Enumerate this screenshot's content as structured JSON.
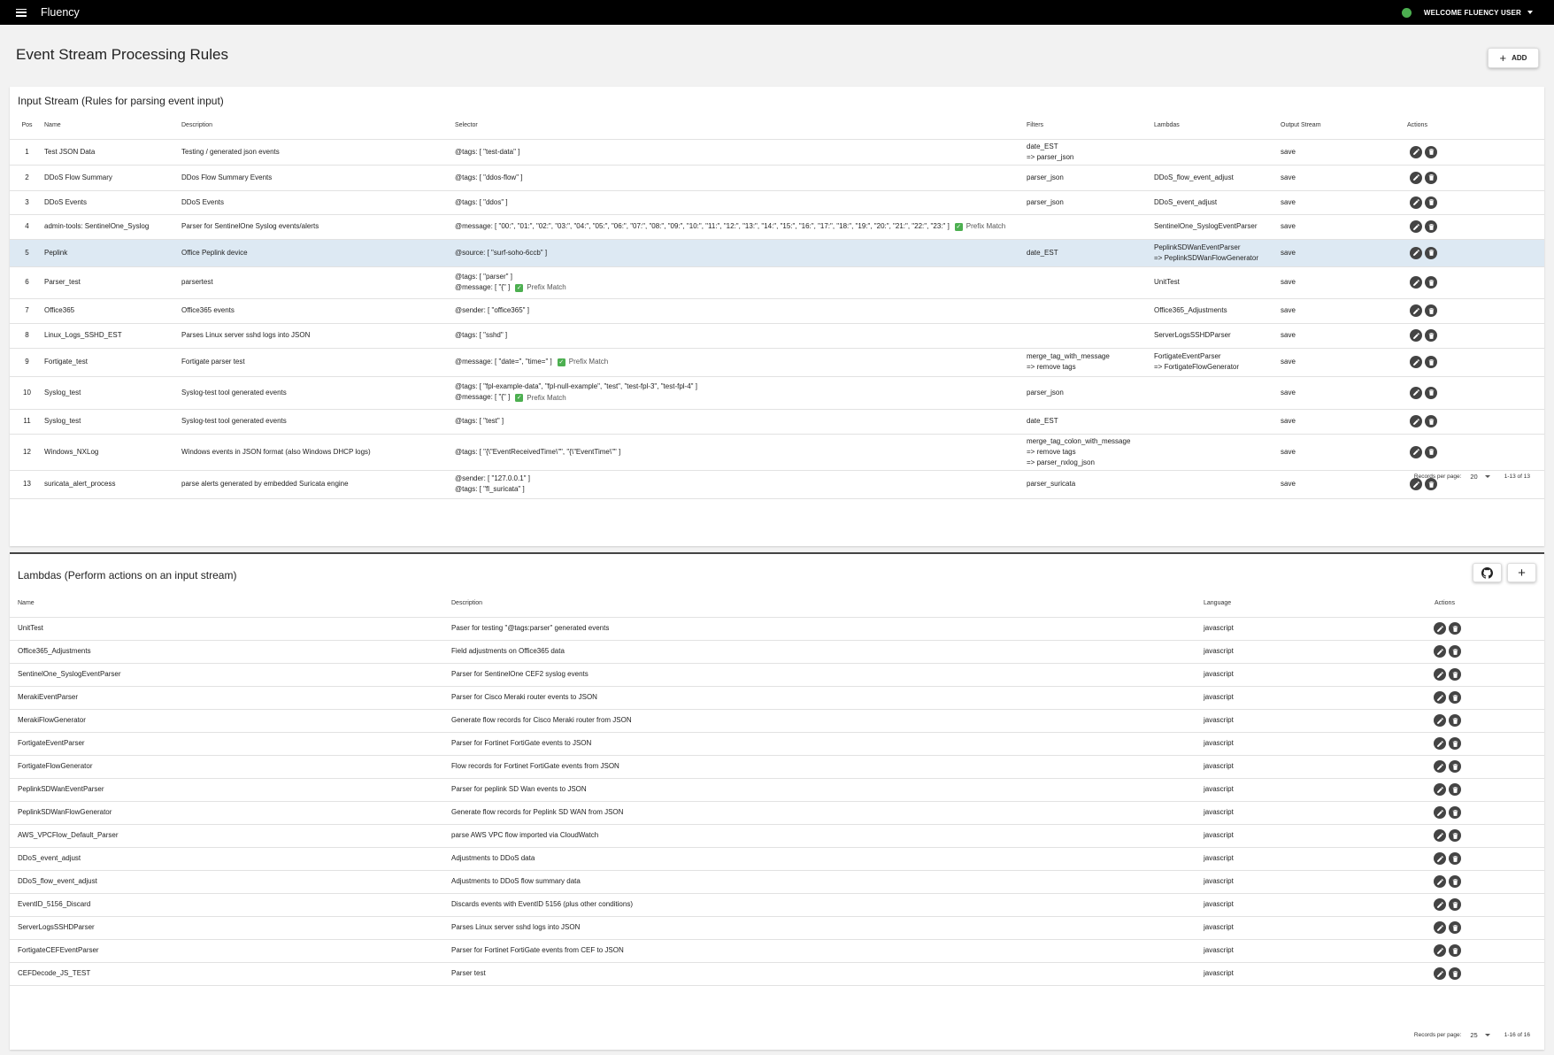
{
  "app": {
    "title": "Fluency",
    "user_label": "WELCOME FLUENCY USER",
    "status_color": "#4caf50"
  },
  "page": {
    "title": "Event Stream Processing Rules",
    "add_label": "ADD"
  },
  "input_stream": {
    "title": "Input Stream (Rules for parsing event input)",
    "columns": [
      "Pos",
      "Name",
      "Description",
      "Selector",
      "Filters",
      "Lambdas",
      "Output Stream",
      "Actions"
    ],
    "rows": [
      {
        "pos": "1",
        "name": "Test JSON Data",
        "description": "Testing / generated json events",
        "selector": [
          {
            "text": "@tags: [ \"test-data\" ]",
            "prefix": false
          }
        ],
        "filters": [
          "date_EST",
          "=> parser_json"
        ],
        "lambdas": [],
        "output": "save",
        "selected": false
      },
      {
        "pos": "2",
        "name": "DDoS Flow Summary",
        "description": "DDos Flow Summary Events",
        "selector": [
          {
            "text": "@tags: [ \"ddos-flow\" ]",
            "prefix": false
          }
        ],
        "filters": [
          "parser_json"
        ],
        "lambdas": [
          "DDoS_flow_event_adjust"
        ],
        "output": "save",
        "selected": false
      },
      {
        "pos": "3",
        "name": "DDoS Events",
        "description": "DDoS Events",
        "selector": [
          {
            "text": "@tags: [ \"ddos\" ]",
            "prefix": false
          }
        ],
        "filters": [
          "parser_json"
        ],
        "lambdas": [
          "DDoS_event_adjust"
        ],
        "output": "save",
        "selected": false
      },
      {
        "pos": "4",
        "name": "admin-tools: SentinelOne_Syslog",
        "description": "Parser for SentinelOne Syslog events/alerts",
        "selector": [
          {
            "text": "@message: [ \"00:\", \"01:\", \"02:\", \"03:\", \"04:\", \"05:\", \"06:\", \"07:\", \"08:\", \"09:\", \"10:\", \"11:\", \"12:\", \"13:\", \"14:\", \"15:\", \"16:\", \"17:\", \"18:\", \"19:\", \"20:\", \"21:\", \"22:\", \"23:\" ]",
            "prefix": true
          }
        ],
        "filters": [],
        "lambdas": [
          "SentinelOne_SyslogEventParser"
        ],
        "output": "save",
        "selected": false
      },
      {
        "pos": "5",
        "name": "Peplink",
        "description": "Office Peplink device",
        "selector": [
          {
            "text": "@source: [ \"surf-soho-6ccb\" ]",
            "prefix": false
          }
        ],
        "filters": [
          "date_EST"
        ],
        "lambdas": [
          "PeplinkSDWanEventParser",
          "=> PeplinkSDWanFlowGenerator"
        ],
        "output": "save",
        "selected": true
      },
      {
        "pos": "6",
        "name": "Parser_test",
        "description": "parsertest",
        "selector": [
          {
            "text": "@tags: [ \"parser\" ]",
            "prefix": false
          },
          {
            "text": "@message: [ \"{\" ]",
            "prefix": true
          }
        ],
        "filters": [],
        "lambdas": [
          "UnitTest"
        ],
        "output": "save",
        "selected": false
      },
      {
        "pos": "7",
        "name": "Office365",
        "description": "Office365 events",
        "selector": [
          {
            "text": "@sender: [ \"office365\" ]",
            "prefix": false
          }
        ],
        "filters": [],
        "lambdas": [
          "Office365_Adjustments"
        ],
        "output": "save",
        "selected": false
      },
      {
        "pos": "8",
        "name": "Linux_Logs_SSHD_EST",
        "description": "Parses Linux server sshd logs into JSON",
        "selector": [
          {
            "text": "@tags: [ \"sshd\" ]",
            "prefix": false
          }
        ],
        "filters": [],
        "lambdas": [
          "ServerLogsSSHDParser"
        ],
        "output": "save",
        "selected": false
      },
      {
        "pos": "9",
        "name": "Fortigate_test",
        "description": "Fortigate parser test",
        "selector": [
          {
            "text": "@message: [ \"date=\", \"time=\" ]",
            "prefix": true
          }
        ],
        "filters": [
          "merge_tag_with_message",
          "=> remove tags"
        ],
        "lambdas": [
          "FortigateEventParser",
          "=> FortigateFlowGenerator"
        ],
        "output": "save",
        "selected": false
      },
      {
        "pos": "10",
        "name": "Syslog_test",
        "description": "Syslog-test tool generated events",
        "selector": [
          {
            "text": "@tags: [ \"fpl-example-data\", \"fpl-null-example\", \"test\", \"test-fpl-3\", \"test-fpl-4\" ]",
            "prefix": false
          },
          {
            "text": "@message: [ \"{\" ]",
            "prefix": true
          }
        ],
        "filters": [
          "parser_json"
        ],
        "lambdas": [],
        "output": "save",
        "selected": false
      },
      {
        "pos": "11",
        "name": "Syslog_test",
        "description": "Syslog-test tool generated events",
        "selector": [
          {
            "text": "@tags: [ \"test\" ]",
            "prefix": false
          }
        ],
        "filters": [
          "date_EST"
        ],
        "lambdas": [],
        "output": "save",
        "selected": false
      },
      {
        "pos": "12",
        "name": "Windows_NXLog",
        "description": "Windows events in JSON format (also Windows DHCP logs)",
        "selector": [
          {
            "text": "@tags: [ \"{\\\"EventReceivedTime\\\"\", \"{\\\"EventTime\\\"\" ]",
            "prefix": false
          }
        ],
        "filters": [
          "merge_tag_colon_with_message",
          "=> remove tags",
          "=> parser_nxlog_json"
        ],
        "lambdas": [],
        "output": "save",
        "selected": false
      },
      {
        "pos": "13",
        "name": "suricata_alert_process",
        "description": "parse alerts generated by embedded Suricata engine",
        "selector": [
          {
            "text": "@sender: [ \"127.0.0.1\" ]",
            "prefix": false
          },
          {
            "text": "@tags: [ \"fl_suricata\" ]",
            "prefix": false
          }
        ],
        "filters": [
          "parser_suricata"
        ],
        "lambdas": [],
        "output": "save",
        "selected": false
      }
    ],
    "pagination": {
      "label": "Records per page:",
      "per_page": "20",
      "range": "1-13 of 13"
    }
  },
  "prefix_label": "Prefix Match",
  "lambdas": {
    "title": "Lambdas (Perform actions on an input stream)",
    "columns": [
      "Name",
      "Description",
      "Language",
      "Actions"
    ],
    "rows": [
      {
        "name": "UnitTest",
        "description": "Paser for testing \"@tags:parser\" generated events",
        "language": "javascript"
      },
      {
        "name": "Office365_Adjustments",
        "description": "Field adjustments on Office365 data",
        "language": "javascript"
      },
      {
        "name": "SentinelOne_SyslogEventParser",
        "description": "Parser for SentinelOne CEF2 syslog events",
        "language": "javascript"
      },
      {
        "name": "MerakiEventParser",
        "description": "Parser for Cisco Meraki router events to JSON",
        "language": "javascript"
      },
      {
        "name": "MerakiFlowGenerator",
        "description": "Generate flow records for Cisco Meraki router from JSON",
        "language": "javascript"
      },
      {
        "name": "FortigateEventParser",
        "description": "Parser for Fortinet FortiGate events to JSON",
        "language": "javascript"
      },
      {
        "name": "FortigateFlowGenerator",
        "description": "Flow records for Fortinet FortiGate events from JSON",
        "language": "javascript"
      },
      {
        "name": "PeplinkSDWanEventParser",
        "description": "Parser for peplink SD Wan events to JSON",
        "language": "javascript"
      },
      {
        "name": "PeplinkSDWanFlowGenerator",
        "description": "Generate flow records for Peplink SD WAN from JSON",
        "language": "javascript"
      },
      {
        "name": "AWS_VPCFlow_Default_Parser",
        "description": "parse AWS VPC flow imported via CloudWatch",
        "language": "javascript"
      },
      {
        "name": "DDoS_event_adjust",
        "description": "Adjustments to DDoS data",
        "language": "javascript"
      },
      {
        "name": "DDoS_flow_event_adjust",
        "description": "Adjustments to DDoS flow summary data",
        "language": "javascript"
      },
      {
        "name": "EventID_5156_Discard",
        "description": "Discards events with EventID 5156 (plus other conditions)",
        "language": "javascript"
      },
      {
        "name": "ServerLogsSSHDParser",
        "description": "Parses Linux server sshd logs into JSON",
        "language": "javascript"
      },
      {
        "name": "FortigateCEFEventParser",
        "description": "Parser for Fortinet FortiGate events from CEF to JSON",
        "language": "javascript"
      },
      {
        "name": "CEFDecode_JS_TEST",
        "description": "Parser test",
        "language": "javascript"
      }
    ],
    "pagination": {
      "label": "Records per page:",
      "per_page": "25",
      "range": "1-16 of 16"
    }
  }
}
